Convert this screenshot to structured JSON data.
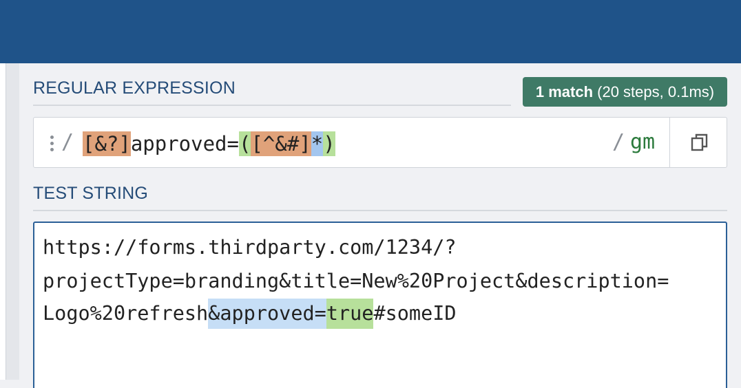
{
  "regex_section": {
    "title": "REGULAR EXPRESSION",
    "match_info": {
      "count": "1 match",
      "detail": " (20 steps, 0.1ms)"
    },
    "delimiter_open": "/",
    "pattern_tokens": [
      {
        "text": "[&?]",
        "kind": "char-set"
      },
      {
        "text": "approved=",
        "kind": "literal"
      },
      {
        "text": "(",
        "kind": "group"
      },
      {
        "text": "[^&#]",
        "kind": "char-set"
      },
      {
        "text": "*",
        "kind": "quantifier"
      },
      {
        "text": ")",
        "kind": "group"
      }
    ],
    "delimiter_close": "/",
    "flags": "gm",
    "icons": {
      "menu": "kebab-menu-icon",
      "copy": "copy-icon"
    }
  },
  "test_section": {
    "title": "TEST STRING",
    "lines": [
      "https://forms.thirdparty.com/1234/?",
      "projectType=branding&title=New%20Project&description=",
      "Logo%20refresh&approved=true#someID"
    ],
    "line3_parts": {
      "before": "Logo%20refresh",
      "match_prefix": "&approved=",
      "match_group": "true",
      "after": "#someID"
    }
  },
  "colors": {
    "header": "#1f5389",
    "badge": "#3f7a66",
    "char_set": "#e0a27a",
    "group": "#b7e09b",
    "quantifier": "#a3c6ef",
    "match_highlight": "#c6def6",
    "flags": "#2b7a3c"
  }
}
